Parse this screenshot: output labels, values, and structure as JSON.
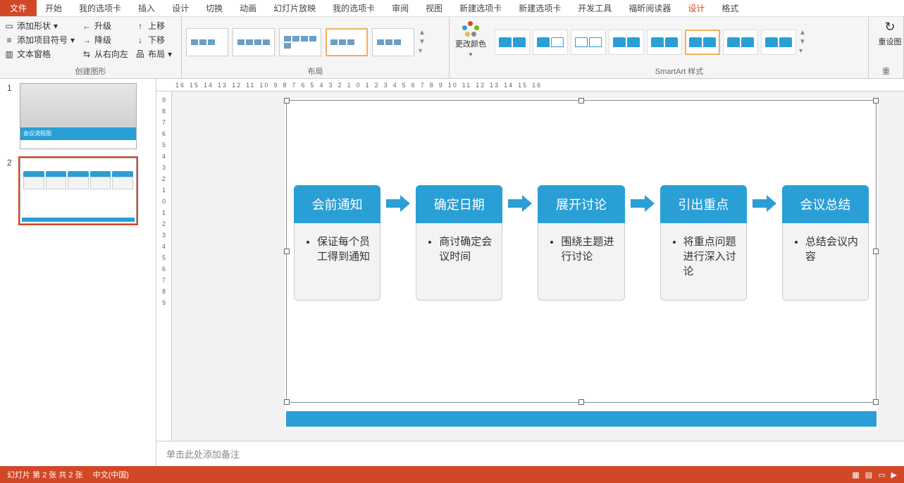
{
  "tabs": {
    "file": "文件",
    "items": [
      "开始",
      "我的选项卡",
      "插入",
      "设计",
      "切换",
      "动画",
      "幻灯片放映",
      "我的选项卡",
      "审阅",
      "视图",
      "新建选项卡",
      "新建选项卡",
      "开发工具",
      "福昕阅读器",
      "设计",
      "格式"
    ],
    "activeIndexes": [
      14
    ]
  },
  "ribbon": {
    "createShapes": {
      "label": "创建图形",
      "addShape": "添加形状",
      "addBullet": "添加项目符号",
      "textPane": "文本窗格",
      "promote": "升级",
      "demote": "降级",
      "rtl": "从右向左",
      "moveUp": "上移",
      "moveDown": "下移",
      "layoutBtn": "布局"
    },
    "layout": {
      "label": "布局"
    },
    "changeColors": "更改颜色",
    "styles": {
      "label": "SmartArt 样式"
    },
    "reset": {
      "label": "重设图",
      "btn": "重"
    }
  },
  "ruler_h": [
    "16",
    "15",
    "14",
    "13",
    "12",
    "11",
    "10",
    "9",
    "8",
    "7",
    "6",
    "5",
    "4",
    "3",
    "2",
    "1",
    "0",
    "1",
    "2",
    "3",
    "4",
    "5",
    "6",
    "7",
    "8",
    "9",
    "10",
    "11",
    "12",
    "13",
    "14",
    "15",
    "16"
  ],
  "ruler_v": [
    "9",
    "8",
    "7",
    "6",
    "5",
    "4",
    "3",
    "2",
    "1",
    "0",
    "1",
    "2",
    "3",
    "4",
    "5",
    "6",
    "7",
    "8",
    "9"
  ],
  "slides": {
    "s1": {
      "num": "1",
      "title": "会议流程图"
    },
    "s2": {
      "num": "2"
    }
  },
  "smartart": {
    "nodes": [
      {
        "title": "会前通知",
        "body": "保证每个员工得到通知"
      },
      {
        "title": "确定日期",
        "body": "商讨确定会议时间"
      },
      {
        "title": "展开讨论",
        "body": "围绕主题进行讨论"
      },
      {
        "title": "引出重点",
        "body": "将重点问题进行深入讨论"
      },
      {
        "title": "会议总结",
        "body": "总结会议内容"
      }
    ]
  },
  "notes_placeholder": "单击此处添加备注",
  "status": {
    "left": "幻灯片 第 2 张  共 2 张",
    "lang": "中文(中国)"
  }
}
